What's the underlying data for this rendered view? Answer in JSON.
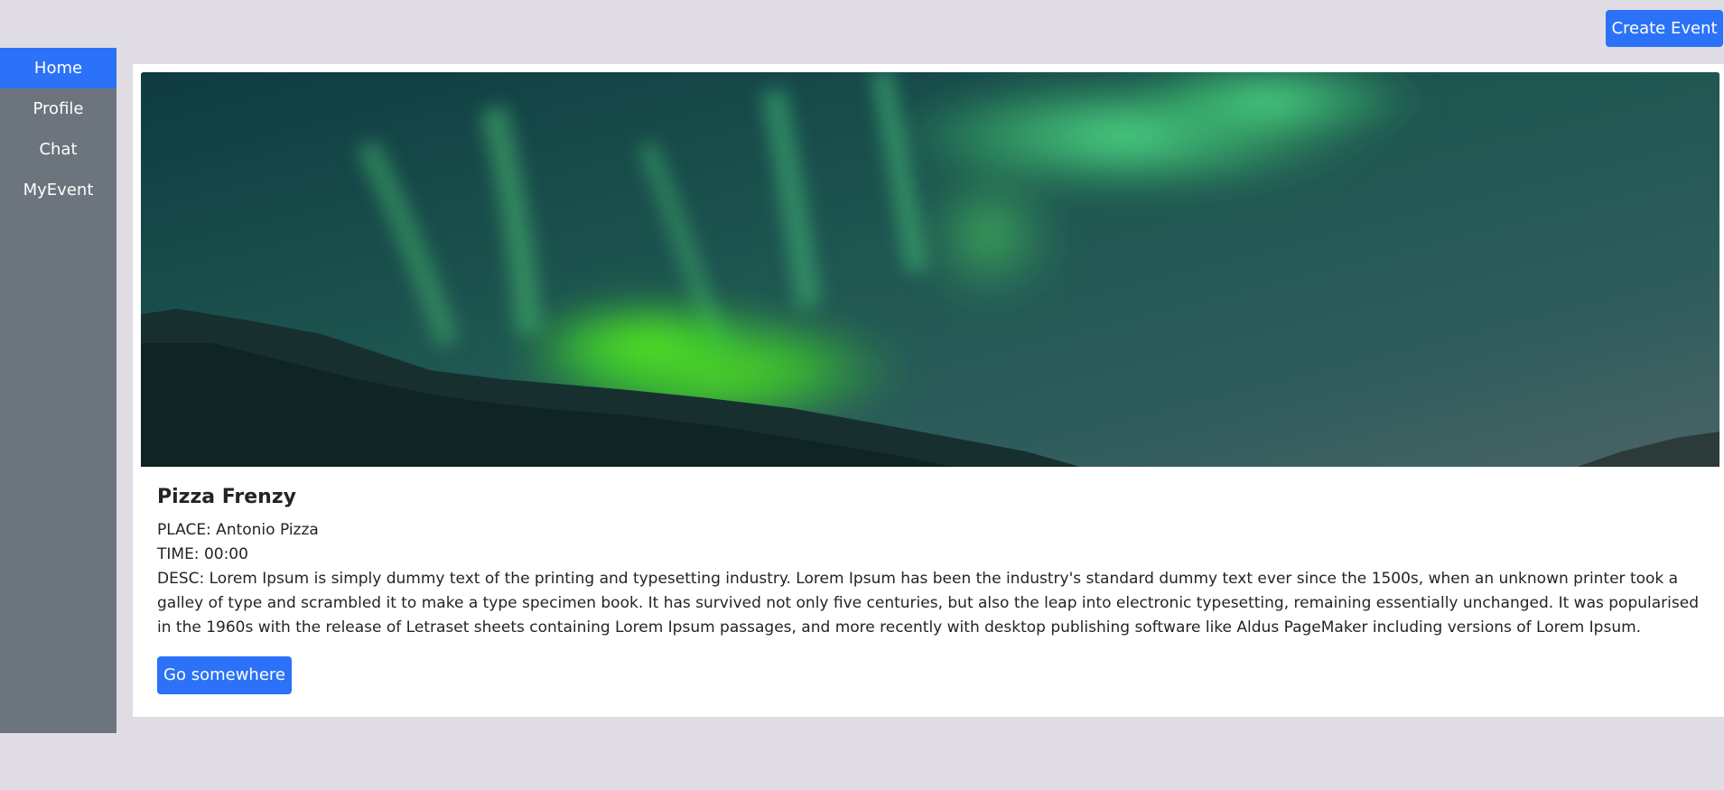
{
  "header": {
    "create_event_label": "Create Event"
  },
  "sidebar": {
    "items": [
      {
        "label": "Home",
        "active": true
      },
      {
        "label": "Profile",
        "active": false
      },
      {
        "label": "Chat",
        "active": false
      },
      {
        "label": "MyEvent",
        "active": false
      }
    ]
  },
  "event_card": {
    "title": "Pizza Frenzy",
    "place": "PLACE: Antonio Pizza",
    "time": "TIME: 00:00",
    "description": "DESC: Lorem Ipsum is simply dummy text of the printing and typesetting industry. Lorem Ipsum has been the industry's standard dummy text ever since the 1500s, when an unknown printer took a galley of type and scrambled it to make a type specimen book. It has survived not only five centuries, but also the leap into electronic typesetting, remaining essentially unchanged. It was popularised in the 1960s with the release of Letraset sheets containing Lorem Ipsum passages, and more recently with desktop publishing software like Aldus PageMaker including versions of Lorem Ipsum.",
    "action_label": "Go somewhere",
    "image_icon": "aurora-landscape-image"
  },
  "colors": {
    "primary": "#2b72f8",
    "sidebar": "#6c757d",
    "page_background": "#dfdce4",
    "card_background": "#ffffff"
  }
}
